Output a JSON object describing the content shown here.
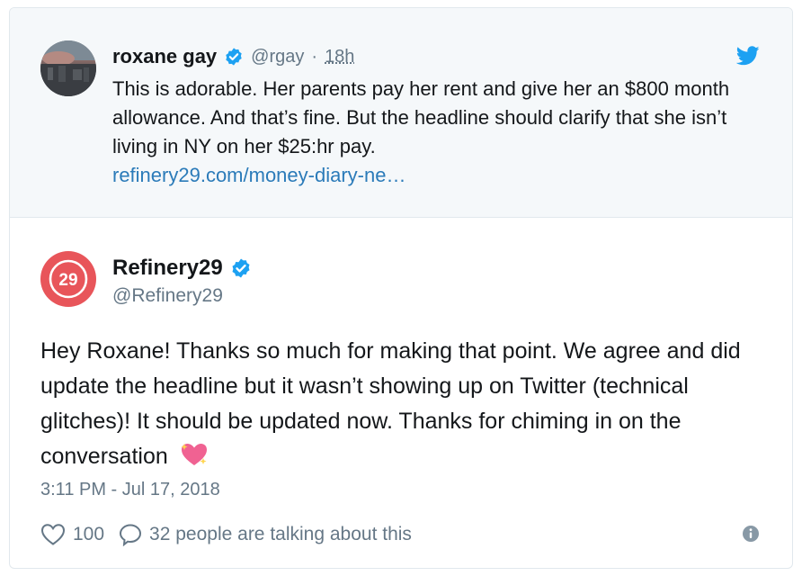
{
  "quoted_tweet": {
    "author_name": "roxane gay",
    "handle": "@rgay",
    "separator": "·",
    "time": "18h",
    "text": "This is adorable. Her parents pay her rent and give her an $800 month allowance. And that’s fine. But the headline should clarify that she isn’t living in NY on her $25:hr pay.",
    "link": "refinery29.com/money-diary-ne…"
  },
  "main_tweet": {
    "author_name": "Refinery29",
    "handle": "@Refinery29",
    "avatar_text": "29",
    "text": "Hey Roxane! Thanks so much for making that point. We agree and did update the headline but it wasn’t showing up on Twitter (technical glitches)! It should be updated now. Thanks for chiming in on the conversation",
    "timestamp": "3:11 PM - Jul 17, 2018",
    "likes": "100",
    "talking": "32 people are talking about this"
  },
  "colors": {
    "verified": "#1da1f2",
    "link": "#2b7bb9",
    "brand_red": "#e8555a",
    "muted": "#657786"
  },
  "icons": [
    "verified-badge-icon",
    "twitter-bird-icon",
    "heart-icon",
    "comment-bubble-icon",
    "info-icon",
    "sparkling-heart-emoji"
  ]
}
